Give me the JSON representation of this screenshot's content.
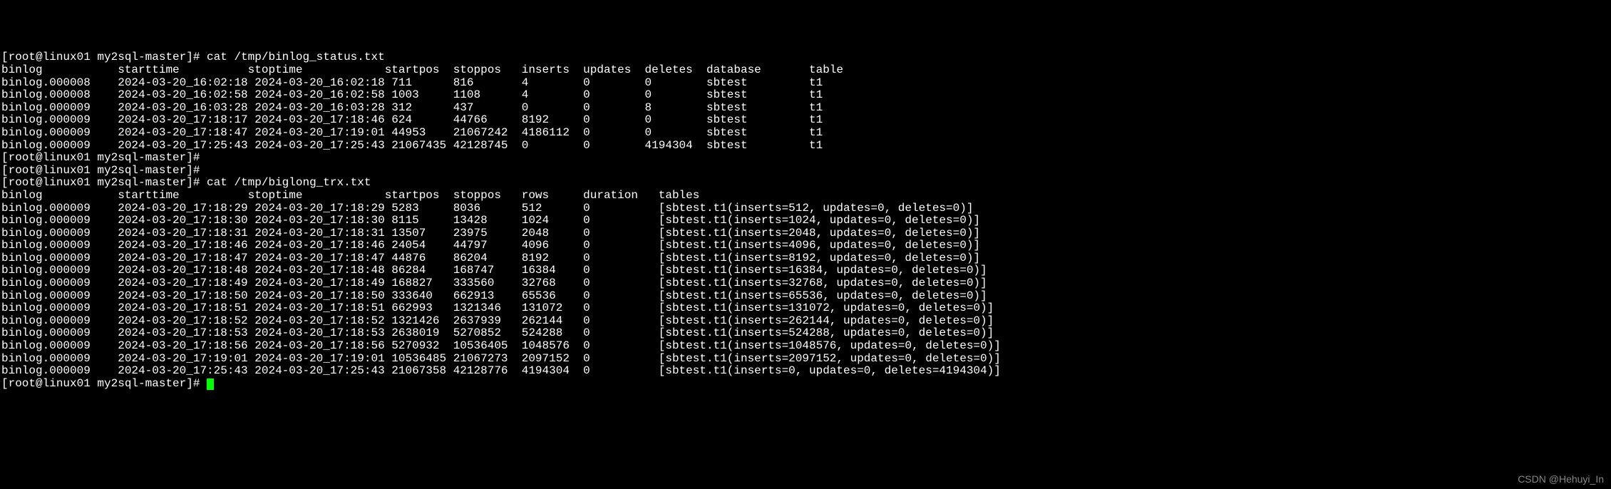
{
  "prompt": "[root@linux01 my2sql-master]# ",
  "cmd1": "cat /tmp/binlog_status.txt",
  "cmd2": "cat /tmp/biglong_trx.txt",
  "table1": {
    "header": {
      "binlog": "binlog",
      "starttime": "starttime",
      "stoptime": "stoptime",
      "startpos": "startpos",
      "stoppos": "stoppos",
      "inserts": "inserts",
      "updates": "updates",
      "deletes": "deletes",
      "database": "database",
      "table": "table"
    },
    "rows": [
      {
        "binlog": "binlog.000008",
        "starttime": "2024-03-20_16:02:18",
        "stoptime": "2024-03-20_16:02:18",
        "startpos": "711",
        "stoppos": "816",
        "inserts": "4",
        "updates": "0",
        "deletes": "0",
        "database": "sbtest",
        "table": "t1"
      },
      {
        "binlog": "binlog.000008",
        "starttime": "2024-03-20_16:02:58",
        "stoptime": "2024-03-20_16:02:58",
        "startpos": "1003",
        "stoppos": "1108",
        "inserts": "4",
        "updates": "0",
        "deletes": "0",
        "database": "sbtest",
        "table": "t1"
      },
      {
        "binlog": "binlog.000009",
        "starttime": "2024-03-20_16:03:28",
        "stoptime": "2024-03-20_16:03:28",
        "startpos": "312",
        "stoppos": "437",
        "inserts": "0",
        "updates": "0",
        "deletes": "8",
        "database": "sbtest",
        "table": "t1"
      },
      {
        "binlog": "binlog.000009",
        "starttime": "2024-03-20_17:18:17",
        "stoptime": "2024-03-20_17:18:46",
        "startpos": "624",
        "stoppos": "44766",
        "inserts": "8192",
        "updates": "0",
        "deletes": "0",
        "database": "sbtest",
        "table": "t1"
      },
      {
        "binlog": "binlog.000009",
        "starttime": "2024-03-20_17:18:47",
        "stoptime": "2024-03-20_17:19:01",
        "startpos": "44953",
        "stoppos": "21067242",
        "inserts": "4186112",
        "updates": "0",
        "deletes": "0",
        "database": "sbtest",
        "table": "t1"
      },
      {
        "binlog": "binlog.000009",
        "starttime": "2024-03-20_17:25:43",
        "stoptime": "2024-03-20_17:25:43",
        "startpos": "21067435",
        "stoppos": "42128745",
        "inserts": "0",
        "updates": "0",
        "deletes": "4194304",
        "database": "sbtest",
        "table": "t1"
      }
    ]
  },
  "table2": {
    "header": {
      "binlog": "binlog",
      "starttime": "starttime",
      "stoptime": "stoptime",
      "startpos": "startpos",
      "stoppos": "stoppos",
      "rows": "rows",
      "duration": "duration",
      "tables": "tables"
    },
    "rows": [
      {
        "binlog": "binlog.000009",
        "starttime": "2024-03-20_17:18:29",
        "stoptime": "2024-03-20_17:18:29",
        "startpos": "5283",
        "stoppos": "8036",
        "rows": "512",
        "duration": "0",
        "tables": "[sbtest.t1(inserts=512, updates=0, deletes=0)]"
      },
      {
        "binlog": "binlog.000009",
        "starttime": "2024-03-20_17:18:30",
        "stoptime": "2024-03-20_17:18:30",
        "startpos": "8115",
        "stoppos": "13428",
        "rows": "1024",
        "duration": "0",
        "tables": "[sbtest.t1(inserts=1024, updates=0, deletes=0)]"
      },
      {
        "binlog": "binlog.000009",
        "starttime": "2024-03-20_17:18:31",
        "stoptime": "2024-03-20_17:18:31",
        "startpos": "13507",
        "stoppos": "23975",
        "rows": "2048",
        "duration": "0",
        "tables": "[sbtest.t1(inserts=2048, updates=0, deletes=0)]"
      },
      {
        "binlog": "binlog.000009",
        "starttime": "2024-03-20_17:18:46",
        "stoptime": "2024-03-20_17:18:46",
        "startpos": "24054",
        "stoppos": "44797",
        "rows": "4096",
        "duration": "0",
        "tables": "[sbtest.t1(inserts=4096, updates=0, deletes=0)]"
      },
      {
        "binlog": "binlog.000009",
        "starttime": "2024-03-20_17:18:47",
        "stoptime": "2024-03-20_17:18:47",
        "startpos": "44876",
        "stoppos": "86204",
        "rows": "8192",
        "duration": "0",
        "tables": "[sbtest.t1(inserts=8192, updates=0, deletes=0)]"
      },
      {
        "binlog": "binlog.000009",
        "starttime": "2024-03-20_17:18:48",
        "stoptime": "2024-03-20_17:18:48",
        "startpos": "86284",
        "stoppos": "168747",
        "rows": "16384",
        "duration": "0",
        "tables": "[sbtest.t1(inserts=16384, updates=0, deletes=0)]"
      },
      {
        "binlog": "binlog.000009",
        "starttime": "2024-03-20_17:18:49",
        "stoptime": "2024-03-20_17:18:49",
        "startpos": "168827",
        "stoppos": "333560",
        "rows": "32768",
        "duration": "0",
        "tables": "[sbtest.t1(inserts=32768, updates=0, deletes=0)]"
      },
      {
        "binlog": "binlog.000009",
        "starttime": "2024-03-20_17:18:50",
        "stoptime": "2024-03-20_17:18:50",
        "startpos": "333640",
        "stoppos": "662913",
        "rows": "65536",
        "duration": "0",
        "tables": "[sbtest.t1(inserts=65536, updates=0, deletes=0)]"
      },
      {
        "binlog": "binlog.000009",
        "starttime": "2024-03-20_17:18:51",
        "stoptime": "2024-03-20_17:18:51",
        "startpos": "662993",
        "stoppos": "1321346",
        "rows": "131072",
        "duration": "0",
        "tables": "[sbtest.t1(inserts=131072, updates=0, deletes=0)]"
      },
      {
        "binlog": "binlog.000009",
        "starttime": "2024-03-20_17:18:52",
        "stoptime": "2024-03-20_17:18:52",
        "startpos": "1321426",
        "stoppos": "2637939",
        "rows": "262144",
        "duration": "0",
        "tables": "[sbtest.t1(inserts=262144, updates=0, deletes=0)]"
      },
      {
        "binlog": "binlog.000009",
        "starttime": "2024-03-20_17:18:53",
        "stoptime": "2024-03-20_17:18:53",
        "startpos": "2638019",
        "stoppos": "5270852",
        "rows": "524288",
        "duration": "0",
        "tables": "[sbtest.t1(inserts=524288, updates=0, deletes=0)]"
      },
      {
        "binlog": "binlog.000009",
        "starttime": "2024-03-20_17:18:56",
        "stoptime": "2024-03-20_17:18:56",
        "startpos": "5270932",
        "stoppos": "10536405",
        "rows": "1048576",
        "duration": "0",
        "tables": "[sbtest.t1(inserts=1048576, updates=0, deletes=0)]"
      },
      {
        "binlog": "binlog.000009",
        "starttime": "2024-03-20_17:19:01",
        "stoptime": "2024-03-20_17:19:01",
        "startpos": "10536485",
        "stoppos": "21067273",
        "rows": "2097152",
        "duration": "0",
        "tables": "[sbtest.t1(inserts=2097152, updates=0, deletes=0)]"
      },
      {
        "binlog": "binlog.000009",
        "starttime": "2024-03-20_17:25:43",
        "stoptime": "2024-03-20_17:25:43",
        "startpos": "21067358",
        "stoppos": "42128776",
        "rows": "4194304",
        "duration": "0",
        "tables": "[sbtest.t1(inserts=0, updates=0, deletes=4194304)]"
      }
    ]
  },
  "watermark": "CSDN @Hehuyi_In"
}
